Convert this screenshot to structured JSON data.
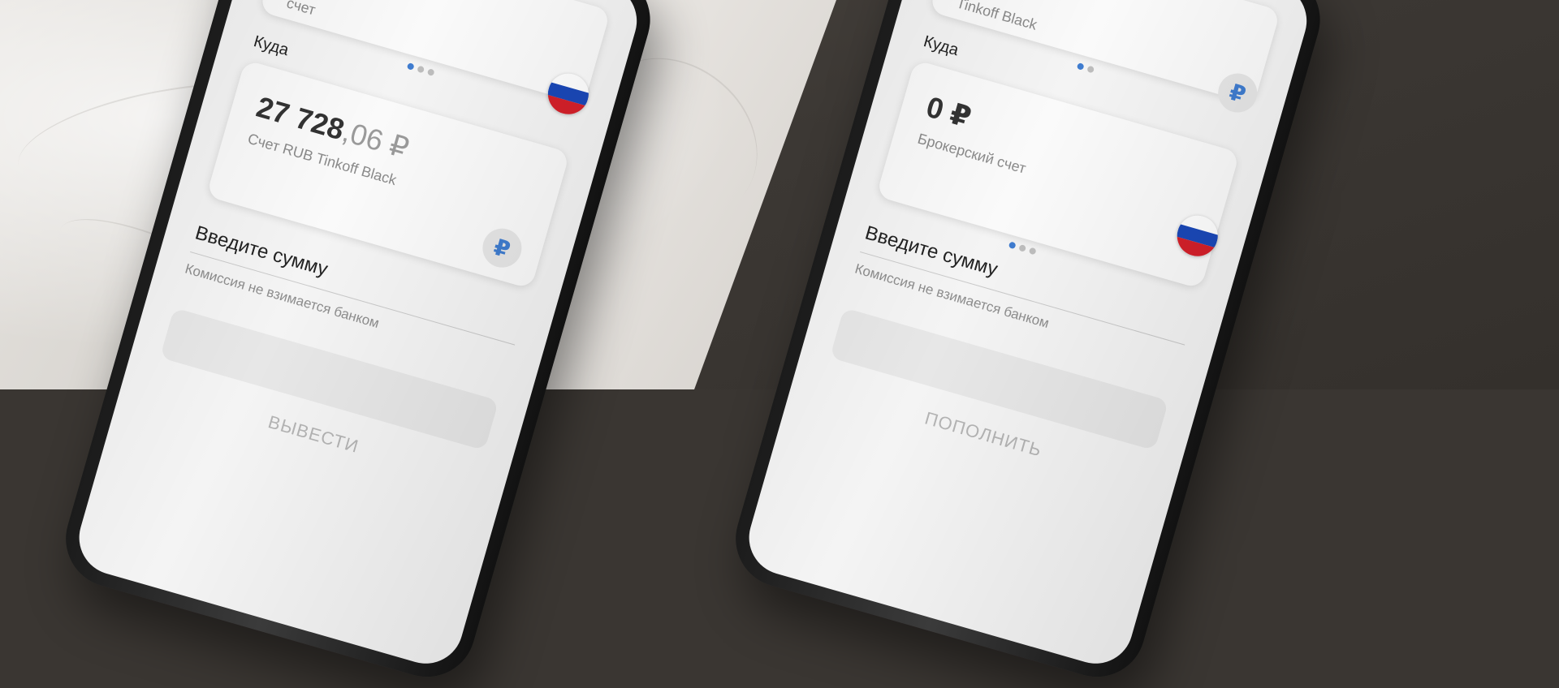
{
  "left_phone": {
    "top_card": {
      "subtitle": "счет"
    },
    "section_label": "Куда",
    "target_card": {
      "amount_int": "27 728",
      "amount_dec": ",06 ₽",
      "account": "Счет RUB Tinkoff Black",
      "currency_symbol": "₽"
    },
    "amount_label": "Введите сумму",
    "commission": "Комиссия не взимается банком",
    "button_label": "ВЫВЕСТИ"
  },
  "right_phone": {
    "top_card": {
      "subtitle": "Tinkoff Black"
    },
    "section_label": "Куда",
    "currency_symbol": "₽",
    "target_card": {
      "amount": "0 ₽",
      "account": "Брокерский счет"
    },
    "amount_label": "Введите сумму",
    "commission": "Комиссия не взимается банком",
    "button_label": "ПОПОЛНИТЬ"
  },
  "icons": {
    "flag": "russia-flag-icon",
    "ruble": "ruble-icon"
  },
  "colors": {
    "accent": "#3f7ccf",
    "flag_white": "#ffffff",
    "flag_blue": "#1a48b8",
    "flag_red": "#d4202a"
  }
}
